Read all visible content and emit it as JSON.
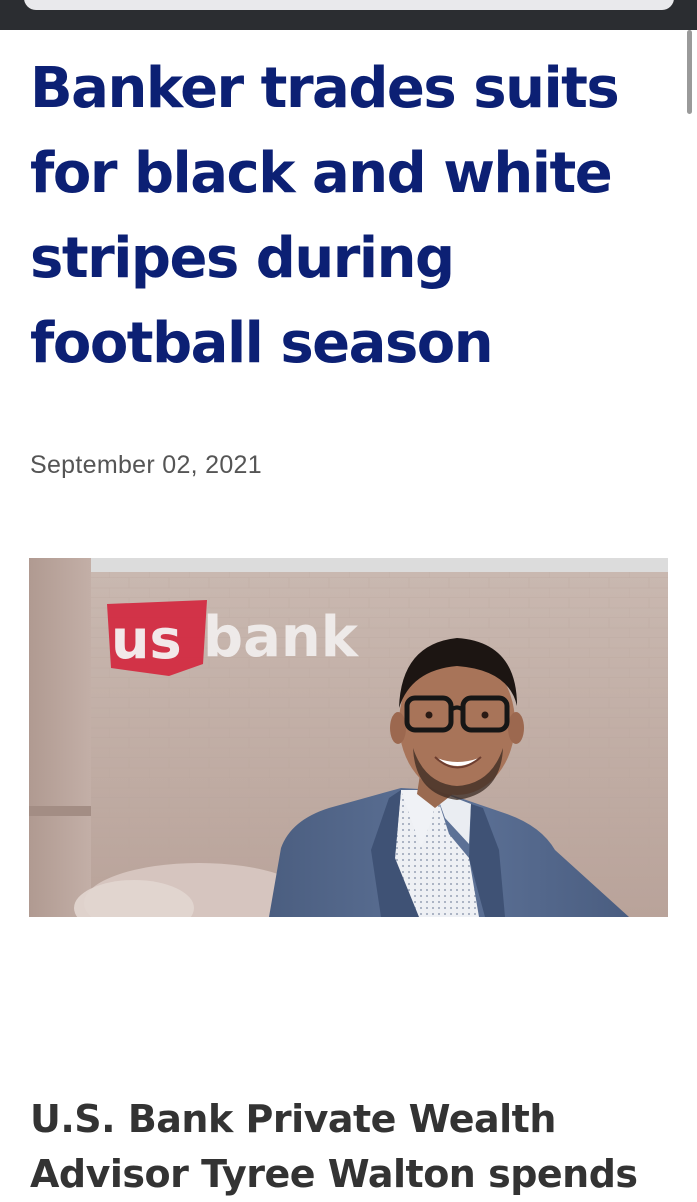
{
  "article": {
    "headline": "Banker trades suits for black and white stripes during football season",
    "date": "September 02, 2021",
    "photo": {
      "sign_text_us": "us",
      "sign_text_bank": "bank"
    },
    "subheadline": "U.S. Bank Private Wealth Advisor Tyree Walton spends"
  },
  "colors": {
    "headline": "#0c2074",
    "date": "#555555",
    "subheadline": "#333333",
    "brand_red": "#d2283f",
    "browser_chrome": "#2b2d31"
  }
}
